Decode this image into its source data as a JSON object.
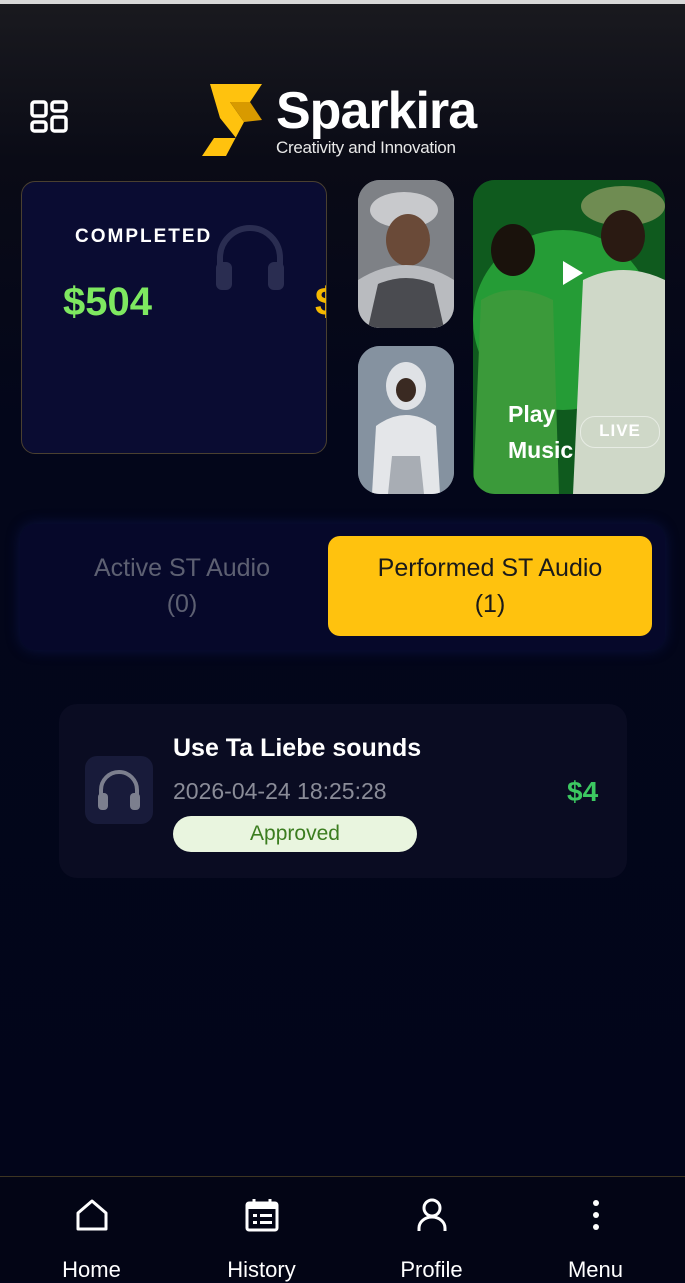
{
  "header": {
    "brand_name": "Sparkira",
    "tagline": "Creativity and Innovation",
    "logo_letter": "S",
    "accent_color": "#ffc20e"
  },
  "summary_card": {
    "label": "COMPLETED",
    "amount": "$504",
    "amount_color": "#7ee860",
    "next_amount_peek": "$"
  },
  "media": {
    "promo_title": "Play Music",
    "live_label": "LIVE"
  },
  "tabs": [
    {
      "label": "Active ST Audio",
      "count": "(0)",
      "active": false
    },
    {
      "label": "Performed ST Audio",
      "count": "(1)",
      "active": true
    }
  ],
  "items": [
    {
      "title": "Use Ta Liebe sounds",
      "datetime": "2026-04-24 18:25:28",
      "status": "Approved",
      "price": "$4",
      "icon": "headphones-icon"
    }
  ],
  "bottom_nav": [
    {
      "label": "Home",
      "icon": "home-icon"
    },
    {
      "label": "History",
      "icon": "calendar-list-icon"
    },
    {
      "label": "Profile",
      "icon": "person-icon"
    },
    {
      "label": "Menu",
      "icon": "more-vertical-icon"
    }
  ]
}
